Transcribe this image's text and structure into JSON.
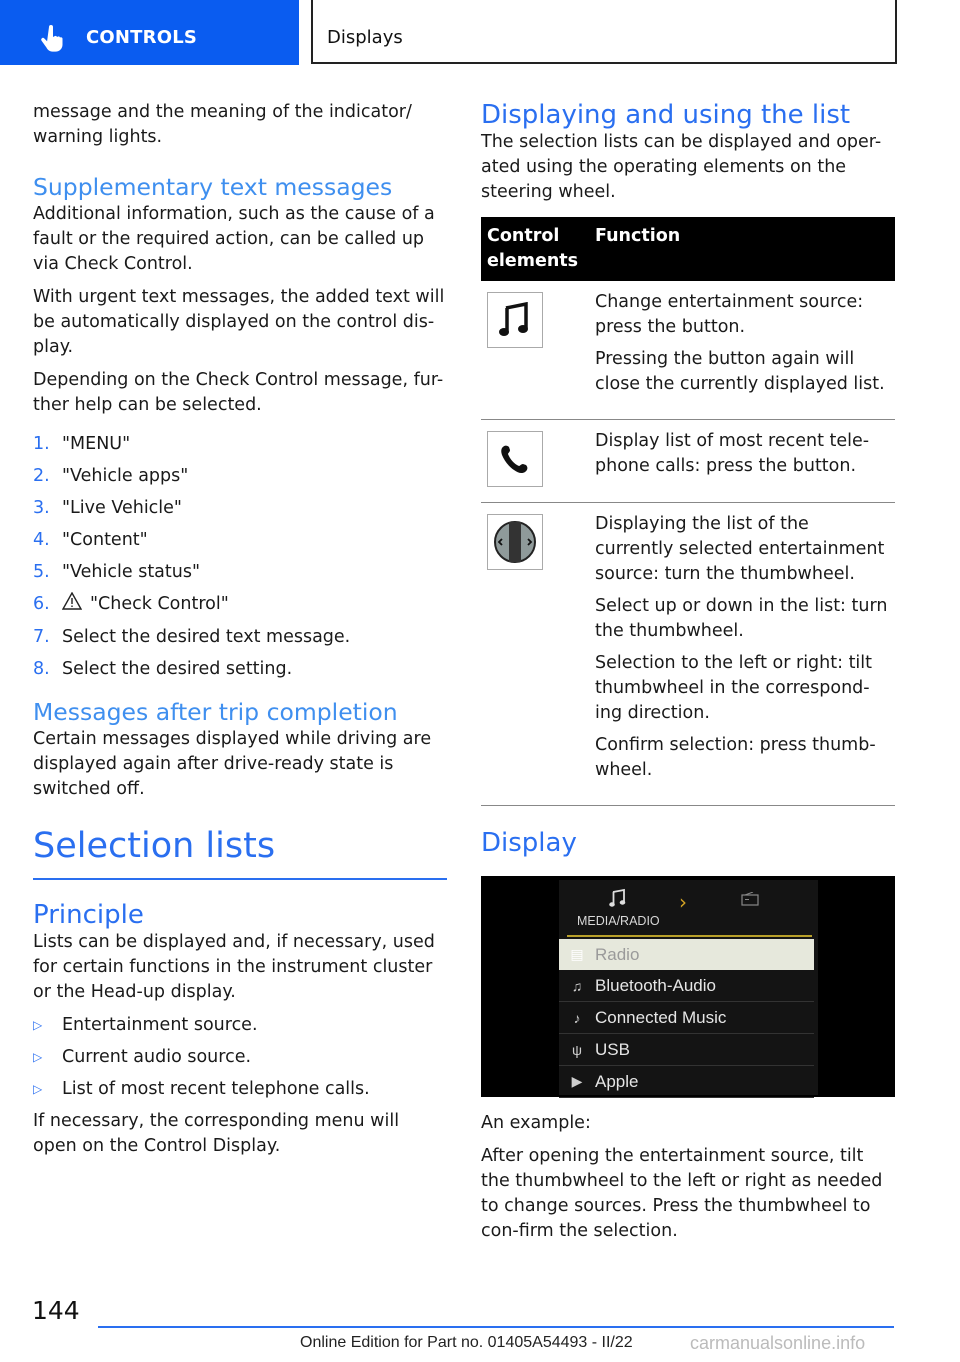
{
  "header": {
    "section_label": "CONTROLS",
    "section_icon": "pointing-hand-icon",
    "chapter_label": "Displays"
  },
  "left": {
    "intro_text": "message and the meaning of the indicator/ warning lights.",
    "supplementary": {
      "heading": "Supplementary text messages",
      "paragraphs": [
        "Additional information, such as the cause of a fault or the required action, can be called up via Check Control.",
        "With urgent text messages, the added text will be automatically displayed on the control dis-play.",
        "Depending on the Check Control message, fur-ther help can be selected."
      ],
      "steps": [
        {
          "num": "1.",
          "text": "\"MENU\""
        },
        {
          "num": "2.",
          "text": "\"Vehicle apps\""
        },
        {
          "num": "3.",
          "text": "\"Live Vehicle\""
        },
        {
          "num": "4.",
          "text": "\"Content\""
        },
        {
          "num": "5.",
          "text": "\"Vehicle status\""
        },
        {
          "num": "6.",
          "text": "\"Check Control\"",
          "icon": "warning-triangle-icon"
        },
        {
          "num": "7.",
          "text": "Select the desired text message."
        },
        {
          "num": "8.",
          "text": "Select the desired setting."
        }
      ]
    },
    "after_trip": {
      "heading": "Messages after trip completion",
      "text": "Certain messages displayed while driving are displayed again after drive-ready state is switched off."
    },
    "selection_lists": {
      "heading": "Selection lists",
      "principle_heading": "Principle",
      "principle_text": "Lists can be displayed and, if necessary, used for certain functions in the instrument cluster or the Head-up display.",
      "bullets": [
        "Entertainment source.",
        "Current audio source.",
        "List of most recent telephone calls."
      ],
      "closing_text": "If necessary, the corresponding menu will open on the Control Display."
    }
  },
  "right": {
    "displaying": {
      "heading": "Displaying and using the list",
      "text": "The selection lists can be displayed and oper-ated using the operating elements on the steering wheel."
    },
    "table": {
      "headers": [
        "Control elements",
        "Function"
      ],
      "rows": [
        {
          "icon": "music-note-icon",
          "paragraphs": [
            "Change entertainment source: press the button.",
            "Pressing the button again will close the currently displayed list."
          ]
        },
        {
          "icon": "phone-handset-icon",
          "paragraphs": [
            "Display list of most recent tele-phone calls: press the button."
          ]
        },
        {
          "icon": "thumbwheel-icon",
          "paragraphs": [
            "Displaying the list of the currently selected entertainment source: turn the thumbwheel.",
            "Select up or down in the list: turn the thumbwheel.",
            "Selection to the left or right: tilt thumbwheel in the correspond-ing direction.",
            "Confirm selection: press thumb-wheel."
          ]
        }
      ]
    },
    "display": {
      "heading": "Display",
      "screen": {
        "title": "MEDIA/RADIO",
        "accent_color": "#d4a324",
        "items": [
          {
            "label": "Radio",
            "icon": "radio-icon",
            "selected": true
          },
          {
            "label": "Bluetooth-Audio",
            "icon": "bluetooth-audio-icon",
            "selected": false
          },
          {
            "label": "Connected Music",
            "icon": "connected-music-icon",
            "selected": false
          },
          {
            "label": "USB",
            "icon": "usb-icon",
            "selected": false
          },
          {
            "label": "Apple",
            "icon": "apple-play-icon",
            "selected": false
          }
        ]
      },
      "example_label": "An example:",
      "example_text": "After opening the entertainment source, tilt the thumbwheel to the left or right as needed to change sources. Press the thumbwheel to con-firm the selection."
    }
  },
  "footer": {
    "page_number": "144",
    "edition_text": "Online Edition for Part no. 01405A54493 - II/22",
    "watermark": "carmanualsonline.info"
  },
  "colors": {
    "brand_blue": "#0a5cf0",
    "heading_blue": "#2a6ff0",
    "subheading_blue": "#3f8fef"
  }
}
